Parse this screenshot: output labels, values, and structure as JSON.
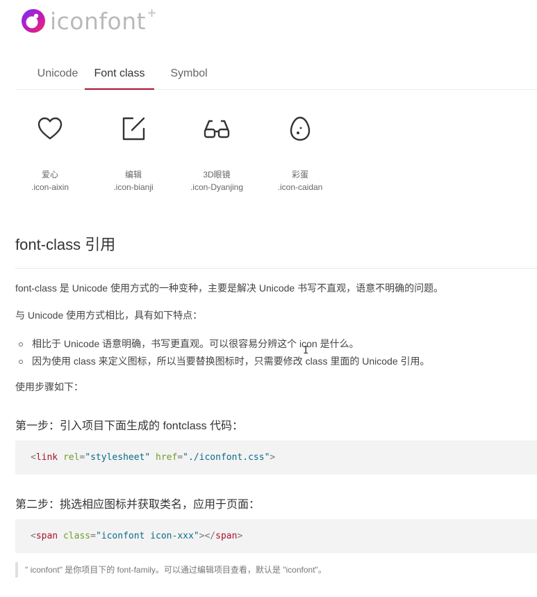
{
  "logo": {
    "text": "iconfont",
    "plus": "+"
  },
  "tabs": [
    {
      "label": "Unicode",
      "active": false
    },
    {
      "label": "Font class",
      "active": true
    },
    {
      "label": "Symbol",
      "active": false
    }
  ],
  "icons": [
    {
      "icon": "heart-icon",
      "name": "爱心",
      "code": ".icon-aixin"
    },
    {
      "icon": "edit-icon",
      "name": "编辑",
      "code": ".icon-bianji"
    },
    {
      "icon": "3d-glasses-icon",
      "name": "3D眼镜",
      "code": ".icon-Dyanjing"
    },
    {
      "icon": "easter-egg-icon",
      "name": "彩蛋",
      "code": ".icon-caidan"
    }
  ],
  "section": {
    "title": "font-class 引用",
    "intro": "font-class 是 Unicode 使用方式的一种变种，主要是解决 Unicode 书写不直观，语意不明确的问题。",
    "compare": "与 Unicode 使用方式相比，具有如下特点：",
    "features": [
      "相比于 Unicode 语意明确，书写更直观。可以很容易分辨这个 icon 是什么。",
      "因为使用 class 来定义图标，所以当要替换图标时，只需要修改 class 里面的 Unicode 引用。"
    ],
    "steps_intro": "使用步骤如下：",
    "step1": {
      "title": "第一步：引入项目下面生成的 fontclass 代码：",
      "code": {
        "open": "<",
        "tag": "link",
        "attr1": "rel",
        "eq": "=",
        "val1": "\"stylesheet\"",
        "attr2": "href",
        "val2": "\"./iconfont.css\"",
        "close": ">"
      }
    },
    "step2": {
      "title": "第二步：挑选相应图标并获取类名，应用于页面：",
      "code": {
        "open": "<",
        "tag": "span",
        "attr1": "class",
        "eq": "=",
        "val1": "\"iconfont icon-xxx\"",
        "close_open": "></",
        "tag_end": "span",
        "close": ">"
      }
    },
    "note": "\" iconfont\" 是你项目下的 font-family。可以通过编辑项目查看，默认是 \"iconfont\"。"
  },
  "colors": {
    "accent": "#a8122b",
    "code_bg": "#f3f3f3",
    "tag": "#a8122b",
    "attr": "#6e9e2f",
    "string": "#0b6b8a"
  }
}
